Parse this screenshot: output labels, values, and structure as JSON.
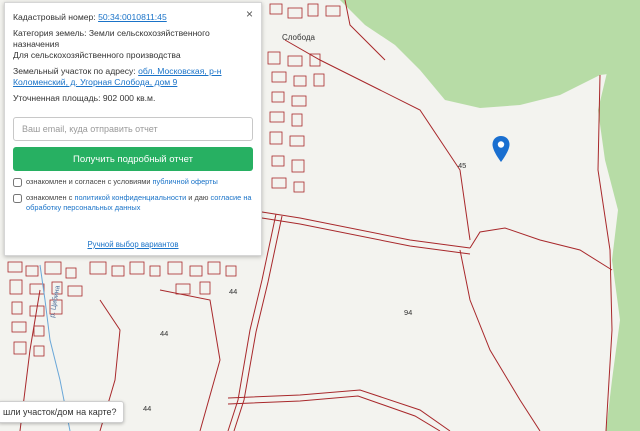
{
  "panel": {
    "cadastral_label": "Кадастровый номер:",
    "cadastral_value": "50:34:0010811:45",
    "category_label": "Категория земель:",
    "category_value": "Земли сельскохозяйственного назначения",
    "usage_value": "Для сельскохозяйственного производства",
    "address_label": "Земельный участок по адресу:",
    "address_value": "обл. Московская, р-н Коломенский, д. Угорная Слобода, дом 9",
    "area_label": "Уточненная площадь:",
    "area_value": "902 000 кв.м.",
    "email_placeholder": "Ваш email, куда отправить отчет",
    "button_label": "Получить подробный отчет",
    "consent1_prefix": "ознакомлен и согласен с условиями",
    "consent1_link": "публичной оферты",
    "consent2_prefix": "ознакомлен с",
    "consent2_link1": "политикой конфиденциальности",
    "consent2_mid": "и даю",
    "consent2_link2": "согласие на обработку персональных данных",
    "manual_link": "Ручной выбор вариантов",
    "close_glyph": "×"
  },
  "map": {
    "labels": [
      {
        "name": "parcel-number-45",
        "text": "45"
      },
      {
        "name": "parcel-number-94",
        "text": "94"
      },
      {
        "name": "parcel-number-44a",
        "text": "44"
      },
      {
        "name": "parcel-number-44b",
        "text": "44"
      },
      {
        "name": "parcel-number-44c",
        "text": "44"
      },
      {
        "name": "village-name-fragment",
        "text": "Слобода"
      },
      {
        "name": "street-name-fragment",
        "text": "р. Цибина"
      }
    ],
    "bottom_tip": "шли участок/дом на карте?",
    "colors": {
      "forest": "#b7dca6",
      "field": "#f3f3ef",
      "boundary": "#a8282b",
      "pin": "#1a6fd0",
      "button": "#27b062"
    }
  }
}
